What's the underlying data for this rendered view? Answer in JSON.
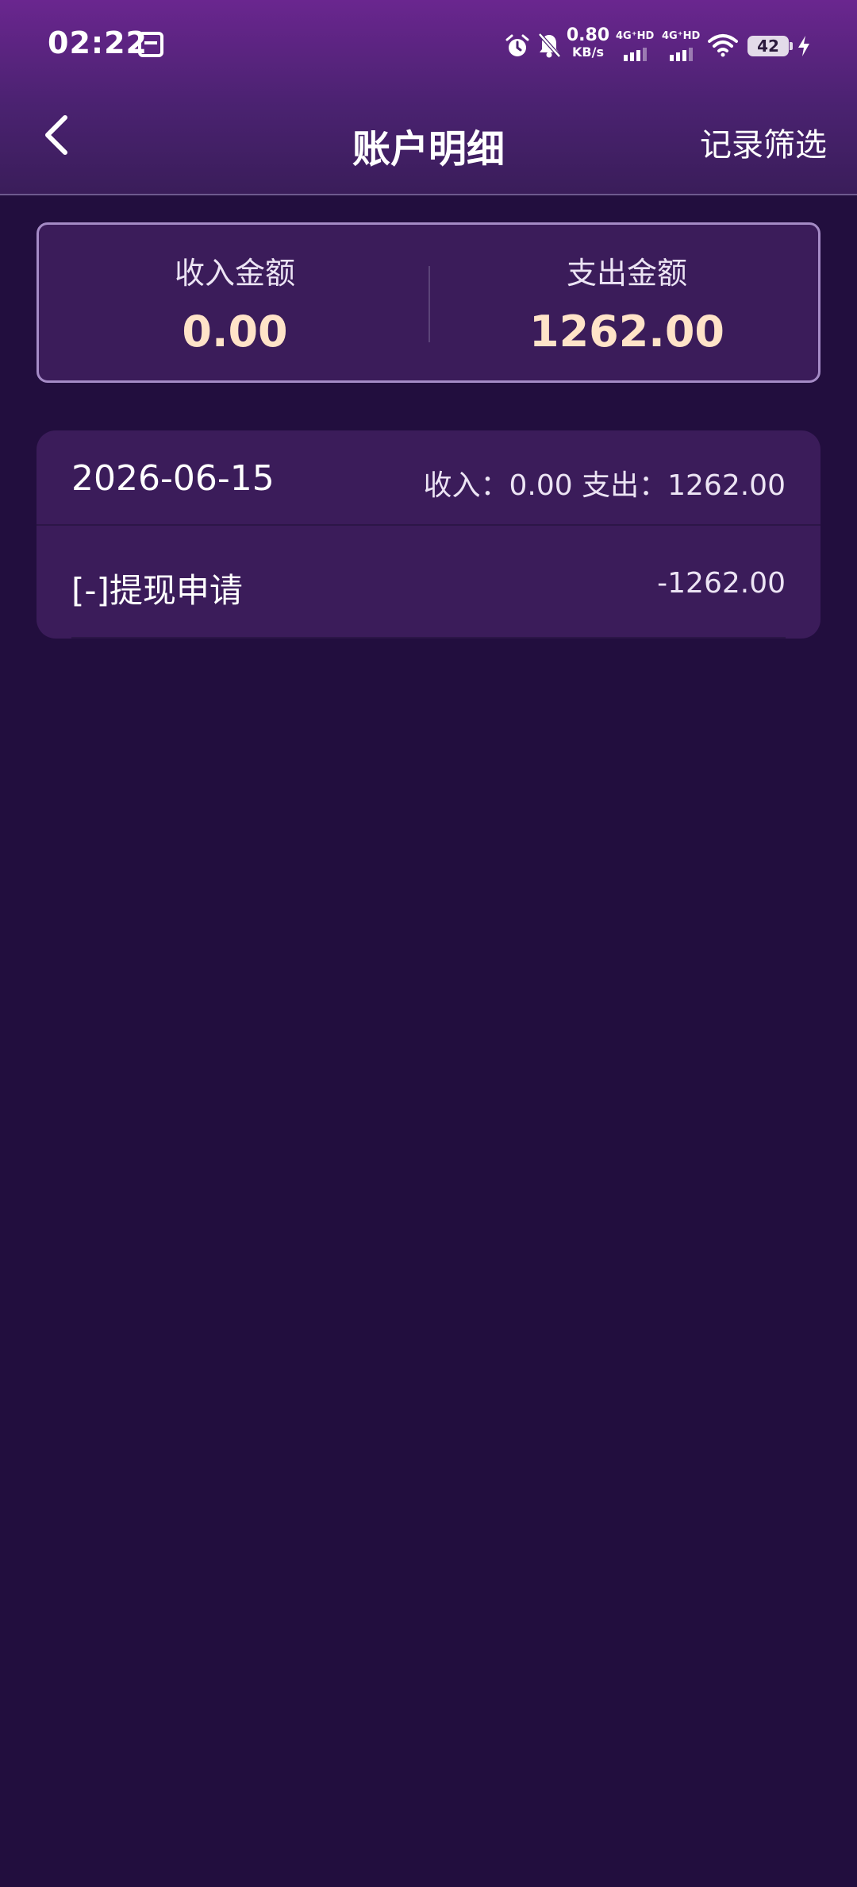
{
  "status_bar": {
    "time": "02:22",
    "net_speed_value": "0.80",
    "net_speed_unit": "KB/s",
    "sim1_label": "4G⁺HD",
    "sim2_label": "4G⁺HD",
    "battery": "42",
    "icons": [
      "sim-card-icon",
      "alarm-icon",
      "bell-off-icon",
      "signal-icon",
      "wifi-icon",
      "battery-icon",
      "charging-icon"
    ]
  },
  "nav": {
    "back_icon": "chevron-left-icon",
    "title": "账户明细",
    "filter_label": "记录筛选"
  },
  "summary": {
    "income_label": "收入金额",
    "income_value": "0.00",
    "expense_label": "支出金额",
    "expense_value": "1262.00"
  },
  "records": {
    "date": "2026-06-15",
    "day_summary": "收入：0.00 支出：1262.00",
    "items": [
      {
        "title": "[-]提现申请",
        "amount": "-1262.00"
      }
    ]
  },
  "colors": {
    "background": "#220e3e",
    "header_top": "#6a268f",
    "card": "#3b1c5a",
    "card_border": "#a58bc6",
    "amount_highlight": "#ffe3c8"
  }
}
